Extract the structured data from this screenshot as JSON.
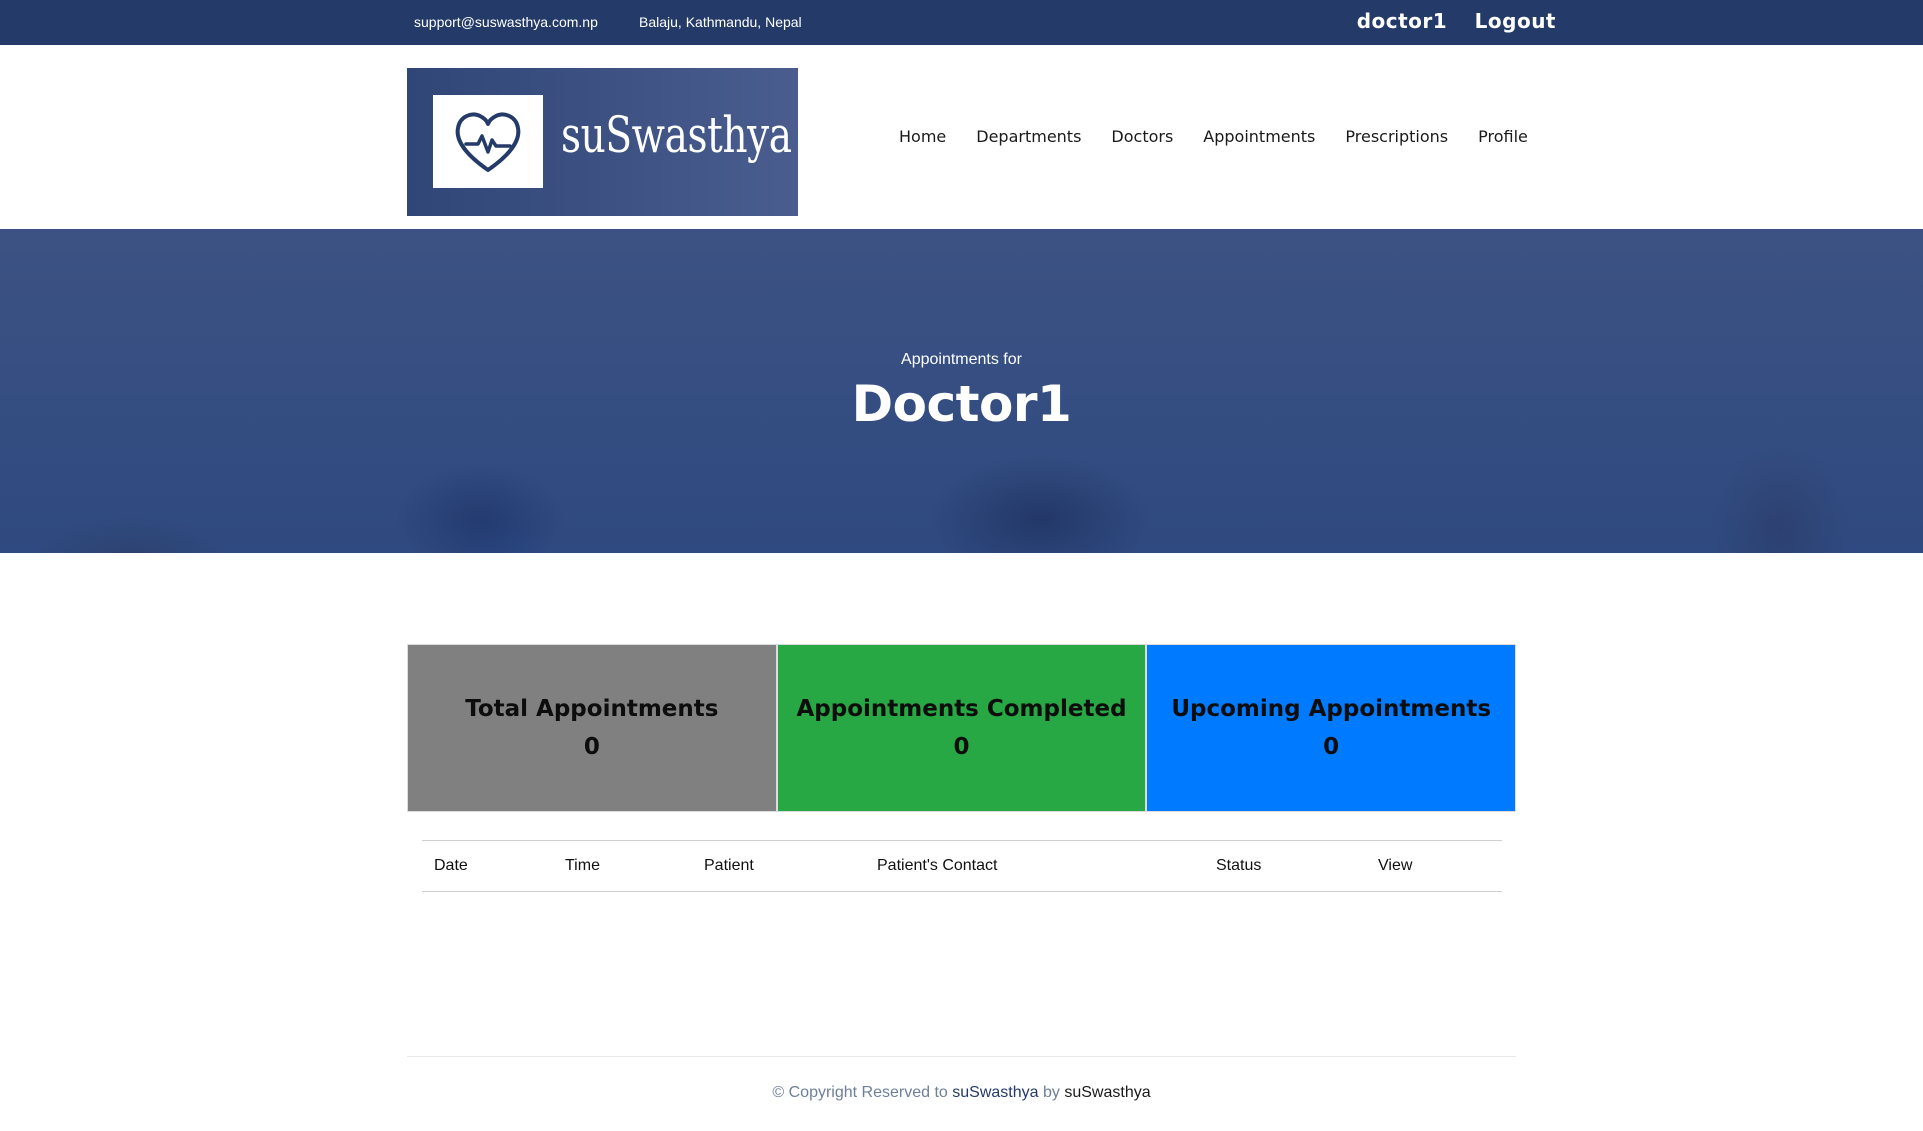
{
  "topbar": {
    "email": "support@suswasthya.com.np",
    "address": "Balaju, Kathmandu, Nepal",
    "username": "doctor1",
    "logout": "Logout"
  },
  "logo": {
    "brand": "suSwasthya",
    "icon": "heart-pulse-icon"
  },
  "nav": [
    "Home",
    "Departments",
    "Doctors",
    "Appointments",
    "Prescriptions",
    "Profile"
  ],
  "hero": {
    "subtitle": "Appointments for",
    "title": "Doctor1"
  },
  "stats": [
    {
      "label": "Total Appointments",
      "value": "0",
      "color": "#808080"
    },
    {
      "label": "Appointments Completed",
      "value": "0",
      "color": "#28a745"
    },
    {
      "label": "Upcoming Appointments",
      "value": "0",
      "color": "#007bff"
    }
  ],
  "table": {
    "columns": [
      "Date",
      "Time",
      "Patient",
      "Patient's Contact",
      "Status",
      "View"
    ],
    "rows": []
  },
  "footer": {
    "copyright": "© Copyright Reserved to",
    "site": "suSwasthya",
    "by": "by",
    "owner": "suSwasthya"
  },
  "colors": {
    "primary": "#243a68"
  }
}
